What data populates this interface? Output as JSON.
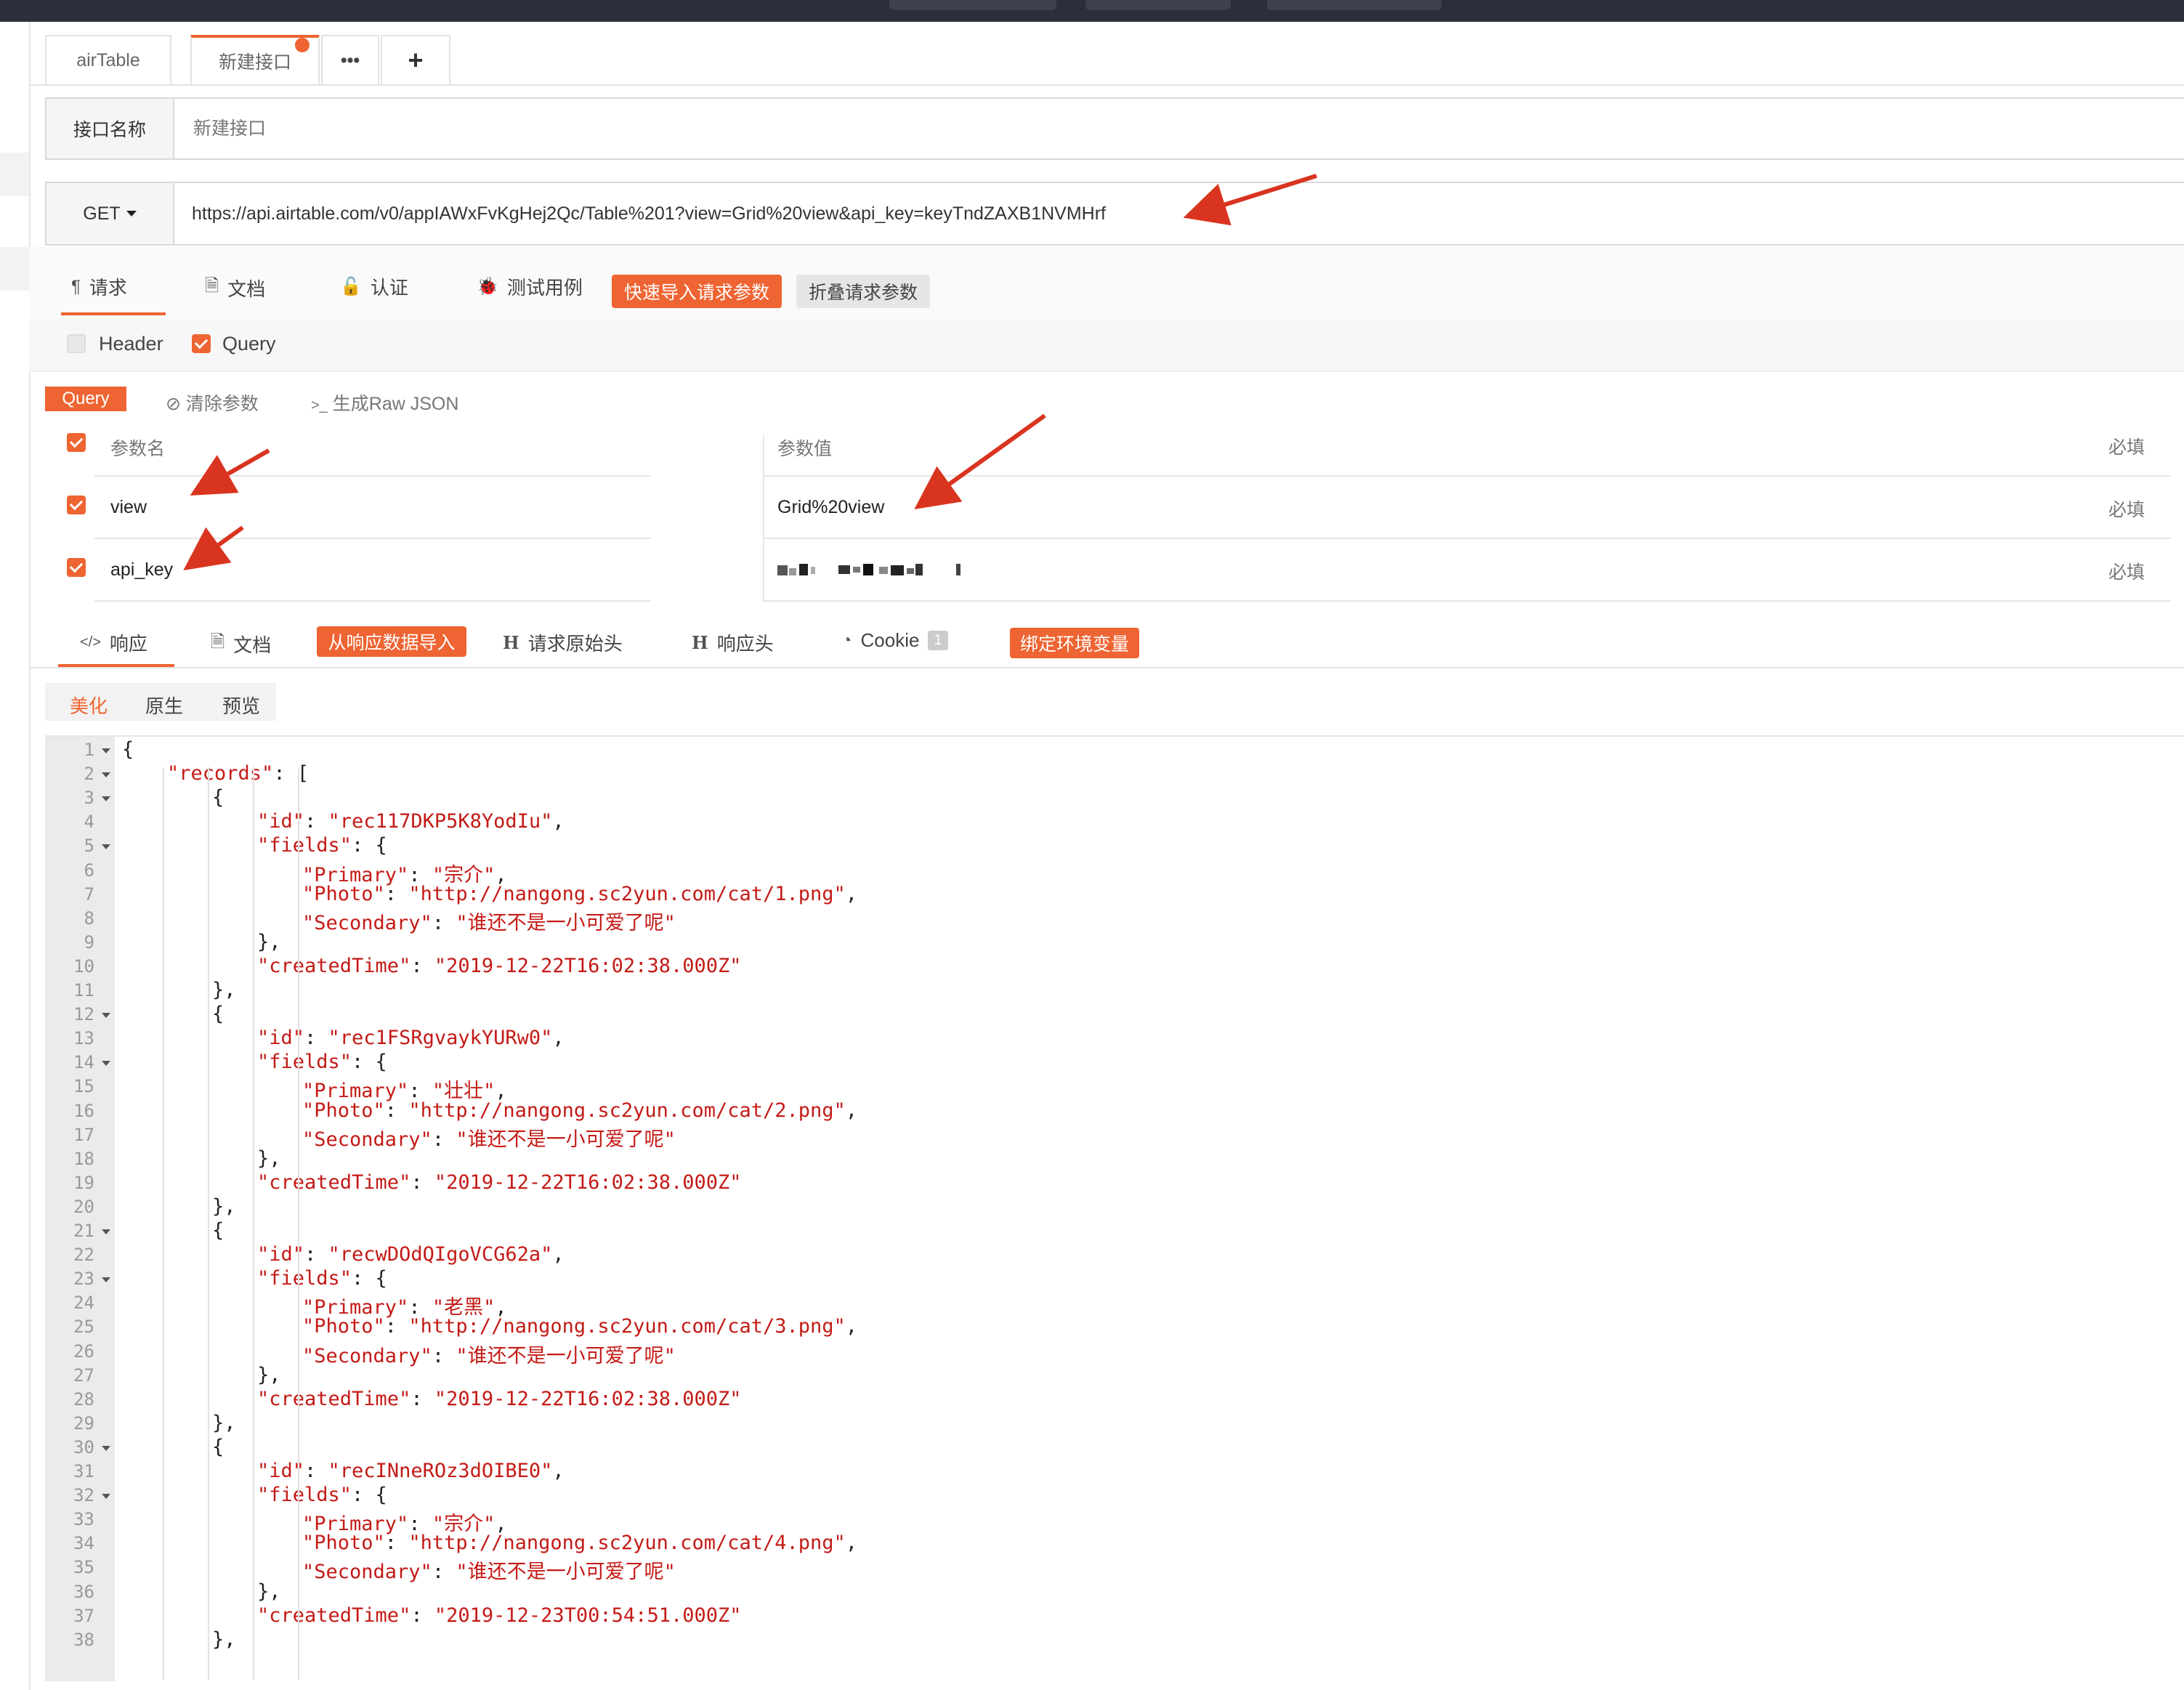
{
  "tabs": [
    {
      "label": "airTable"
    },
    {
      "label": "新建接口"
    },
    {
      "label": "•••"
    },
    {
      "label": "+"
    }
  ],
  "name_row": {
    "label": "接口名称",
    "placeholder": "新建接口"
  },
  "url_row": {
    "method": "GET",
    "url": "https://api.airtable.com/v0/appIAWxFvKgHej2Qc/Table%201?view=Grid%20view&api_key=keyTndZAXB1NVMHrf"
  },
  "request_tabs": [
    {
      "icon": "pilcrow-icon",
      "glyph": "¶",
      "label": "请求"
    },
    {
      "icon": "document-icon",
      "glyph": "🗎",
      "label": "文档"
    },
    {
      "icon": "unlock-icon",
      "glyph": "🔓",
      "label": "认证"
    },
    {
      "icon": "bug-icon",
      "glyph": "🐞",
      "label": "测试用例"
    }
  ],
  "request_actions": {
    "quick_import": "快速导入请求参数",
    "collapse": "折叠请求参数"
  },
  "param_types": [
    {
      "label": "Header",
      "checked": false
    },
    {
      "label": "Query",
      "checked": true
    }
  ],
  "query_toolbar": {
    "tag": "Query",
    "clear": "清除参数",
    "raw_json": "生成Raw JSON",
    "clear_glyph": "⊘",
    "raw_glyph": ">_"
  },
  "params_table": {
    "headers": {
      "name": "参数名",
      "value": "参数值",
      "required": "必填"
    },
    "rows": [
      {
        "name": "view",
        "value": "Grid%20view",
        "required": "必填",
        "checked": true
      },
      {
        "name": "api_key",
        "value": "",
        "required": "必填",
        "checked": true,
        "value_blurred": true
      }
    ]
  },
  "response_tabs": [
    {
      "icon": "code-icon",
      "glyph": "</>",
      "label": "响应"
    },
    {
      "icon": "document-icon",
      "glyph": "🗎",
      "label": "文档"
    },
    {
      "label": "从响应数据导入",
      "style": "orange"
    },
    {
      "icon": "header-icon",
      "glyph": "H",
      "label": "请求原始头"
    },
    {
      "icon": "header-icon",
      "glyph": "H",
      "label": "响应头"
    },
    {
      "icon": "gauge-icon",
      "glyph": "◔",
      "label": "Cookie",
      "badge": "1"
    },
    {
      "label": "绑定环境变量",
      "style": "orange"
    }
  ],
  "format_tabs": [
    {
      "label": "美化",
      "active": true
    },
    {
      "label": "原生",
      "active": false
    },
    {
      "label": "预览",
      "active": false
    }
  ],
  "code_lines": [
    {
      "n": "1",
      "fold": true,
      "indent": 0,
      "parts": [
        [
          "p",
          "{"
        ]
      ]
    },
    {
      "n": "2",
      "fold": true,
      "indent": 1,
      "parts": [
        [
          "k",
          "\"records\""
        ],
        [
          "p",
          ": ["
        ]
      ]
    },
    {
      "n": "3",
      "fold": true,
      "indent": 2,
      "parts": [
        [
          "p",
          "{"
        ]
      ]
    },
    {
      "n": "4",
      "fold": false,
      "indent": 3,
      "parts": [
        [
          "k",
          "\"id\""
        ],
        [
          "p",
          ": "
        ],
        [
          "s",
          "\"rec117DKP5K8YodIu\""
        ],
        [
          "p",
          ","
        ]
      ]
    },
    {
      "n": "5",
      "fold": true,
      "indent": 3,
      "parts": [
        [
          "k",
          "\"fields\""
        ],
        [
          "p",
          ": {"
        ]
      ]
    },
    {
      "n": "6",
      "fold": false,
      "indent": 4,
      "parts": [
        [
          "k",
          "\"Primary\""
        ],
        [
          "p",
          ": "
        ],
        [
          "s",
          "\"宗介\""
        ],
        [
          "p",
          ","
        ]
      ]
    },
    {
      "n": "7",
      "fold": false,
      "indent": 4,
      "parts": [
        [
          "k",
          "\"Photo\""
        ],
        [
          "p",
          ": "
        ],
        [
          "s",
          "\"http://nangong.sc2yun.com/cat/1.png\""
        ],
        [
          "p",
          ","
        ]
      ]
    },
    {
      "n": "8",
      "fold": false,
      "indent": 4,
      "parts": [
        [
          "k",
          "\"Secondary\""
        ],
        [
          "p",
          ": "
        ],
        [
          "s",
          "\"谁还不是一小可爱了呢\""
        ]
      ]
    },
    {
      "n": "9",
      "fold": false,
      "indent": 3,
      "parts": [
        [
          "p",
          "},"
        ]
      ]
    },
    {
      "n": "10",
      "fold": false,
      "indent": 3,
      "parts": [
        [
          "k",
          "\"createdTime\""
        ],
        [
          "p",
          ": "
        ],
        [
          "s",
          "\"2019-12-22T16:02:38.000Z\""
        ]
      ]
    },
    {
      "n": "11",
      "fold": false,
      "indent": 2,
      "parts": [
        [
          "p",
          "},"
        ]
      ]
    },
    {
      "n": "12",
      "fold": true,
      "indent": 2,
      "parts": [
        [
          "p",
          "{"
        ]
      ]
    },
    {
      "n": "13",
      "fold": false,
      "indent": 3,
      "parts": [
        [
          "k",
          "\"id\""
        ],
        [
          "p",
          ": "
        ],
        [
          "s",
          "\"rec1FSRgvaykYURw0\""
        ],
        [
          "p",
          ","
        ]
      ]
    },
    {
      "n": "14",
      "fold": true,
      "indent": 3,
      "parts": [
        [
          "k",
          "\"fields\""
        ],
        [
          "p",
          ": {"
        ]
      ]
    },
    {
      "n": "15",
      "fold": false,
      "indent": 4,
      "parts": [
        [
          "k",
          "\"Primary\""
        ],
        [
          "p",
          ": "
        ],
        [
          "s",
          "\"壮壮\""
        ],
        [
          "p",
          ","
        ]
      ]
    },
    {
      "n": "16",
      "fold": false,
      "indent": 4,
      "parts": [
        [
          "k",
          "\"Photo\""
        ],
        [
          "p",
          ": "
        ],
        [
          "s",
          "\"http://nangong.sc2yun.com/cat/2.png\""
        ],
        [
          "p",
          ","
        ]
      ]
    },
    {
      "n": "17",
      "fold": false,
      "indent": 4,
      "parts": [
        [
          "k",
          "\"Secondary\""
        ],
        [
          "p",
          ": "
        ],
        [
          "s",
          "\"谁还不是一小可爱了呢\""
        ]
      ]
    },
    {
      "n": "18",
      "fold": false,
      "indent": 3,
      "parts": [
        [
          "p",
          "},"
        ]
      ]
    },
    {
      "n": "19",
      "fold": false,
      "indent": 3,
      "parts": [
        [
          "k",
          "\"createdTime\""
        ],
        [
          "p",
          ": "
        ],
        [
          "s",
          "\"2019-12-22T16:02:38.000Z\""
        ]
      ]
    },
    {
      "n": "20",
      "fold": false,
      "indent": 2,
      "parts": [
        [
          "p",
          "},"
        ]
      ]
    },
    {
      "n": "21",
      "fold": true,
      "indent": 2,
      "parts": [
        [
          "p",
          "{"
        ]
      ]
    },
    {
      "n": "22",
      "fold": false,
      "indent": 3,
      "parts": [
        [
          "k",
          "\"id\""
        ],
        [
          "p",
          ": "
        ],
        [
          "s",
          "\"recwDOdQIgoVCG62a\""
        ],
        [
          "p",
          ","
        ]
      ]
    },
    {
      "n": "23",
      "fold": true,
      "indent": 3,
      "parts": [
        [
          "k",
          "\"fields\""
        ],
        [
          "p",
          ": {"
        ]
      ]
    },
    {
      "n": "24",
      "fold": false,
      "indent": 4,
      "parts": [
        [
          "k",
          "\"Primary\""
        ],
        [
          "p",
          ": "
        ],
        [
          "s",
          "\"老黑\""
        ],
        [
          "p",
          ","
        ]
      ]
    },
    {
      "n": "25",
      "fold": false,
      "indent": 4,
      "parts": [
        [
          "k",
          "\"Photo\""
        ],
        [
          "p",
          ": "
        ],
        [
          "s",
          "\"http://nangong.sc2yun.com/cat/3.png\""
        ],
        [
          "p",
          ","
        ]
      ]
    },
    {
      "n": "26",
      "fold": false,
      "indent": 4,
      "parts": [
        [
          "k",
          "\"Secondary\""
        ],
        [
          "p",
          ": "
        ],
        [
          "s",
          "\"谁还不是一小可爱了呢\""
        ]
      ]
    },
    {
      "n": "27",
      "fold": false,
      "indent": 3,
      "parts": [
        [
          "p",
          "},"
        ]
      ]
    },
    {
      "n": "28",
      "fold": false,
      "indent": 3,
      "parts": [
        [
          "k",
          "\"createdTime\""
        ],
        [
          "p",
          ": "
        ],
        [
          "s",
          "\"2019-12-22T16:02:38.000Z\""
        ]
      ]
    },
    {
      "n": "29",
      "fold": false,
      "indent": 2,
      "parts": [
        [
          "p",
          "},"
        ]
      ]
    },
    {
      "n": "30",
      "fold": true,
      "indent": 2,
      "parts": [
        [
          "p",
          "{"
        ]
      ]
    },
    {
      "n": "31",
      "fold": false,
      "indent": 3,
      "parts": [
        [
          "k",
          "\"id\""
        ],
        [
          "p",
          ": "
        ],
        [
          "s",
          "\"recINneROz3dOIBE0\""
        ],
        [
          "p",
          ","
        ]
      ]
    },
    {
      "n": "32",
      "fold": true,
      "indent": 3,
      "parts": [
        [
          "k",
          "\"fields\""
        ],
        [
          "p",
          ": {"
        ]
      ]
    },
    {
      "n": "33",
      "fold": false,
      "indent": 4,
      "parts": [
        [
          "k",
          "\"Primary\""
        ],
        [
          "p",
          ": "
        ],
        [
          "s",
          "\"宗介\""
        ],
        [
          "p",
          ","
        ]
      ]
    },
    {
      "n": "34",
      "fold": false,
      "indent": 4,
      "parts": [
        [
          "k",
          "\"Photo\""
        ],
        [
          "p",
          ": "
        ],
        [
          "s",
          "\"http://nangong.sc2yun.com/cat/4.png\""
        ],
        [
          "p",
          ","
        ]
      ]
    },
    {
      "n": "35",
      "fold": false,
      "indent": 4,
      "parts": [
        [
          "k",
          "\"Secondary\""
        ],
        [
          "p",
          ": "
        ],
        [
          "s",
          "\"谁还不是一小可爱了呢\""
        ]
      ]
    },
    {
      "n": "36",
      "fold": false,
      "indent": 3,
      "parts": [
        [
          "p",
          "},"
        ]
      ]
    },
    {
      "n": "37",
      "fold": false,
      "indent": 3,
      "parts": [
        [
          "k",
          "\"createdTime\""
        ],
        [
          "p",
          ": "
        ],
        [
          "s",
          "\"2019-12-23T00:54:51.000Z\""
        ]
      ]
    },
    {
      "n": "38",
      "fold": false,
      "indent": 2,
      "parts": [
        [
          "p",
          "},"
        ]
      ]
    }
  ],
  "colors": {
    "accent": "#ee6432",
    "annotation_arrow": "#d9341f",
    "json_string": "#c41a16"
  }
}
